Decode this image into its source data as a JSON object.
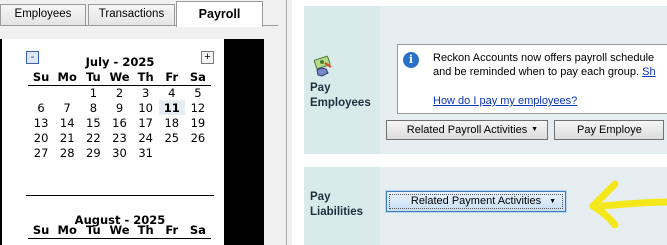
{
  "tabs": [
    {
      "label": "Employees"
    },
    {
      "label": "Transactions"
    },
    {
      "label": "Payroll"
    }
  ],
  "calendar": {
    "prev_label": "-",
    "next_label": "+",
    "weekdays": [
      "Su",
      "Mo",
      "Tu",
      "We",
      "Th",
      "Fr",
      "Sa"
    ],
    "months": [
      {
        "title": "July - 2025",
        "weeks": [
          [
            "",
            "",
            "1",
            "2",
            "3",
            "4",
            "5"
          ],
          [
            "6",
            "7",
            "8",
            "9",
            "10",
            "11",
            "12"
          ],
          [
            "13",
            "14",
            "15",
            "16",
            "17",
            "18",
            "19"
          ],
          [
            "20",
            "21",
            "22",
            "23",
            "24",
            "25",
            "26"
          ],
          [
            "27",
            "28",
            "29",
            "30",
            "31",
            "",
            ""
          ]
        ],
        "today": "11"
      },
      {
        "title": "August - 2025",
        "weeks": []
      }
    ]
  },
  "pay_employees": {
    "label_line1": "Pay",
    "label_line2": "Employees",
    "info_line1": "Reckon Accounts now offers payroll schedule",
    "info_line2_prefix": "and be reminded when to pay each group.",
    "info_line2_link": "Sh",
    "help_link": "How do I pay my employees?",
    "related_button": "Related Payroll Activities",
    "pay_button": "Pay Employe"
  },
  "pay_liabilities": {
    "label_line1": "Pay",
    "label_line2": "Liabilities",
    "related_button": "Related Payment Activities"
  },
  "colors": {
    "section_bg": "#e7eef2",
    "label_col_bg": "#d8eaea",
    "link": "#0b33b8",
    "annotation_arrow": "#f5e81a"
  },
  "icons": {
    "pay_employees": "pay-employees-icon",
    "info": "info-icon",
    "dropdown": "dropdown-arrow-icon",
    "annotation": "annotation-arrow-icon"
  }
}
